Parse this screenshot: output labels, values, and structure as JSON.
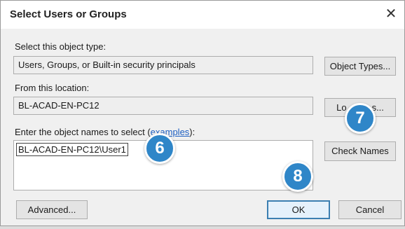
{
  "dialog": {
    "title": "Select Users or Groups",
    "close_symbol": "✕",
    "object_type_label": "Select this object type:",
    "object_type_value": "Users, Groups, or Built-in security principals",
    "object_types_button": "Object Types...",
    "location_label": "From this location:",
    "location_value": "BL-ACAD-EN-PC12",
    "locations_button_left": "Lo",
    "locations_button_right": "s...",
    "names_label_prefix": "Enter the object names to select (",
    "names_label_link": "examples",
    "names_label_suffix": "):",
    "names_value": "BL-ACAD-EN-PC12\\User1",
    "check_names_button": "Check Names",
    "advanced_button": "Advanced...",
    "ok_button": "OK",
    "cancel_button": "Cancel"
  },
  "callouts": {
    "six": "6",
    "seven": "7",
    "eight": "8"
  },
  "colors": {
    "callout": "#2f86c8",
    "default_button_border": "#3c7fb1",
    "link": "#1e5fc2"
  }
}
